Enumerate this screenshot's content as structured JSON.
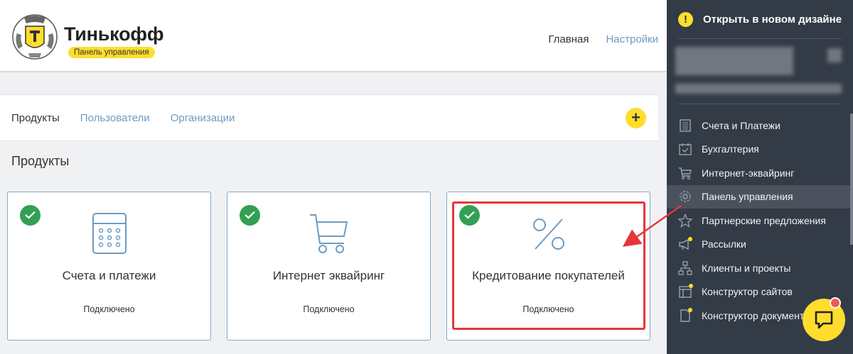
{
  "header": {
    "brand": "Тинькофф",
    "badge": "Панель управления",
    "nav": {
      "home": "Главная",
      "settings": "Настройки"
    }
  },
  "tabs": [
    {
      "label": "Продукты"
    },
    {
      "label": "Пользователи"
    },
    {
      "label": "Организации"
    }
  ],
  "add_button": "+",
  "section_title": "Продукты",
  "cards": [
    {
      "title": "Счета и платежи",
      "status": "Подключено",
      "icon": "calculator-icon"
    },
    {
      "title": "Интернет эквайринг",
      "status": "Подключено",
      "icon": "cart-icon"
    },
    {
      "title": "Кредитование покупателей",
      "status": "Подключено",
      "icon": "percent-icon"
    }
  ],
  "sidebar": {
    "new_design": "Открыть в новом дизайне",
    "warn_icon": "!",
    "menu": [
      {
        "label": "Счета и Платежи",
        "icon": "ledger-icon",
        "active": false,
        "dot": false
      },
      {
        "label": "Бухгалтерия",
        "icon": "calendar-check-icon",
        "active": false,
        "dot": false
      },
      {
        "label": "Интернет-эквайринг",
        "icon": "cart-icon",
        "active": false,
        "dot": false
      },
      {
        "label": "Панель управления",
        "icon": "gear-icon",
        "active": true,
        "dot": false
      },
      {
        "label": "Партнерские предложения",
        "icon": "star-icon",
        "active": false,
        "dot": false
      },
      {
        "label": "Рассылки",
        "icon": "megaphone-icon",
        "active": false,
        "dot": true
      },
      {
        "label": "Клиенты и проекты",
        "icon": "hierarchy-icon",
        "active": false,
        "dot": false
      },
      {
        "label": "Конструктор сайтов",
        "icon": "layout-icon",
        "active": false,
        "dot": true
      },
      {
        "label": "Конструктор документов",
        "icon": "document-icon",
        "active": false,
        "dot": true
      }
    ]
  },
  "colors": {
    "accent": "#ffdd2d",
    "link": "#6d9bc3",
    "check": "#32a052",
    "highlight": "#e3373c",
    "sidebar": "#333b47"
  }
}
